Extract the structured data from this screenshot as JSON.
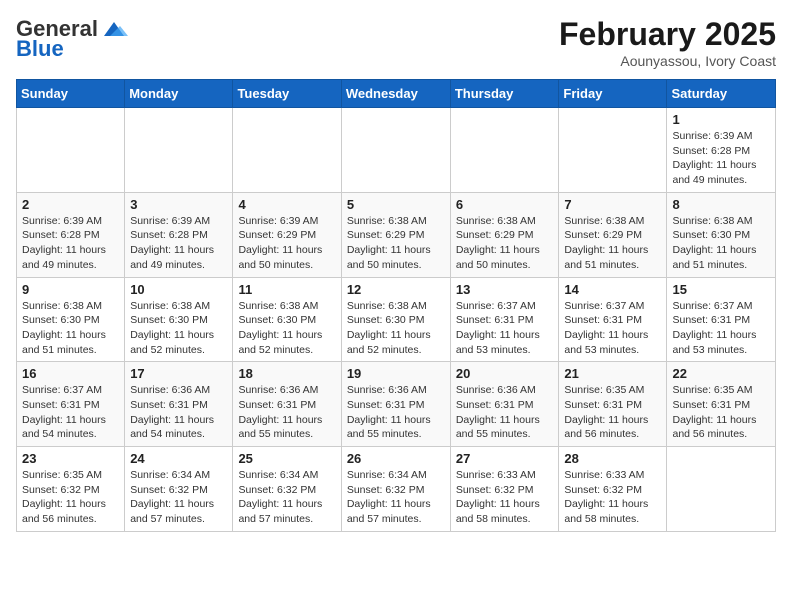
{
  "header": {
    "logo_general": "General",
    "logo_blue": "Blue",
    "month": "February 2025",
    "location": "Aounyassou, Ivory Coast"
  },
  "weekdays": [
    "Sunday",
    "Monday",
    "Tuesday",
    "Wednesday",
    "Thursday",
    "Friday",
    "Saturday"
  ],
  "weeks": [
    [
      {
        "day": "",
        "info": ""
      },
      {
        "day": "",
        "info": ""
      },
      {
        "day": "",
        "info": ""
      },
      {
        "day": "",
        "info": ""
      },
      {
        "day": "",
        "info": ""
      },
      {
        "day": "",
        "info": ""
      },
      {
        "day": "1",
        "info": "Sunrise: 6:39 AM\nSunset: 6:28 PM\nDaylight: 11 hours and 49 minutes."
      }
    ],
    [
      {
        "day": "2",
        "info": "Sunrise: 6:39 AM\nSunset: 6:28 PM\nDaylight: 11 hours and 49 minutes."
      },
      {
        "day": "3",
        "info": "Sunrise: 6:39 AM\nSunset: 6:28 PM\nDaylight: 11 hours and 49 minutes."
      },
      {
        "day": "4",
        "info": "Sunrise: 6:39 AM\nSunset: 6:29 PM\nDaylight: 11 hours and 50 minutes."
      },
      {
        "day": "5",
        "info": "Sunrise: 6:38 AM\nSunset: 6:29 PM\nDaylight: 11 hours and 50 minutes."
      },
      {
        "day": "6",
        "info": "Sunrise: 6:38 AM\nSunset: 6:29 PM\nDaylight: 11 hours and 50 minutes."
      },
      {
        "day": "7",
        "info": "Sunrise: 6:38 AM\nSunset: 6:29 PM\nDaylight: 11 hours and 51 minutes."
      },
      {
        "day": "8",
        "info": "Sunrise: 6:38 AM\nSunset: 6:30 PM\nDaylight: 11 hours and 51 minutes."
      }
    ],
    [
      {
        "day": "9",
        "info": "Sunrise: 6:38 AM\nSunset: 6:30 PM\nDaylight: 11 hours and 51 minutes."
      },
      {
        "day": "10",
        "info": "Sunrise: 6:38 AM\nSunset: 6:30 PM\nDaylight: 11 hours and 52 minutes."
      },
      {
        "day": "11",
        "info": "Sunrise: 6:38 AM\nSunset: 6:30 PM\nDaylight: 11 hours and 52 minutes."
      },
      {
        "day": "12",
        "info": "Sunrise: 6:38 AM\nSunset: 6:30 PM\nDaylight: 11 hours and 52 minutes."
      },
      {
        "day": "13",
        "info": "Sunrise: 6:37 AM\nSunset: 6:31 PM\nDaylight: 11 hours and 53 minutes."
      },
      {
        "day": "14",
        "info": "Sunrise: 6:37 AM\nSunset: 6:31 PM\nDaylight: 11 hours and 53 minutes."
      },
      {
        "day": "15",
        "info": "Sunrise: 6:37 AM\nSunset: 6:31 PM\nDaylight: 11 hours and 53 minutes."
      }
    ],
    [
      {
        "day": "16",
        "info": "Sunrise: 6:37 AM\nSunset: 6:31 PM\nDaylight: 11 hours and 54 minutes."
      },
      {
        "day": "17",
        "info": "Sunrise: 6:36 AM\nSunset: 6:31 PM\nDaylight: 11 hours and 54 minutes."
      },
      {
        "day": "18",
        "info": "Sunrise: 6:36 AM\nSunset: 6:31 PM\nDaylight: 11 hours and 55 minutes."
      },
      {
        "day": "19",
        "info": "Sunrise: 6:36 AM\nSunset: 6:31 PM\nDaylight: 11 hours and 55 minutes."
      },
      {
        "day": "20",
        "info": "Sunrise: 6:36 AM\nSunset: 6:31 PM\nDaylight: 11 hours and 55 minutes."
      },
      {
        "day": "21",
        "info": "Sunrise: 6:35 AM\nSunset: 6:31 PM\nDaylight: 11 hours and 56 minutes."
      },
      {
        "day": "22",
        "info": "Sunrise: 6:35 AM\nSunset: 6:31 PM\nDaylight: 11 hours and 56 minutes."
      }
    ],
    [
      {
        "day": "23",
        "info": "Sunrise: 6:35 AM\nSunset: 6:32 PM\nDaylight: 11 hours and 56 minutes."
      },
      {
        "day": "24",
        "info": "Sunrise: 6:34 AM\nSunset: 6:32 PM\nDaylight: 11 hours and 57 minutes."
      },
      {
        "day": "25",
        "info": "Sunrise: 6:34 AM\nSunset: 6:32 PM\nDaylight: 11 hours and 57 minutes."
      },
      {
        "day": "26",
        "info": "Sunrise: 6:34 AM\nSunset: 6:32 PM\nDaylight: 11 hours and 57 minutes."
      },
      {
        "day": "27",
        "info": "Sunrise: 6:33 AM\nSunset: 6:32 PM\nDaylight: 11 hours and 58 minutes."
      },
      {
        "day": "28",
        "info": "Sunrise: 6:33 AM\nSunset: 6:32 PM\nDaylight: 11 hours and 58 minutes."
      },
      {
        "day": "",
        "info": ""
      }
    ]
  ]
}
